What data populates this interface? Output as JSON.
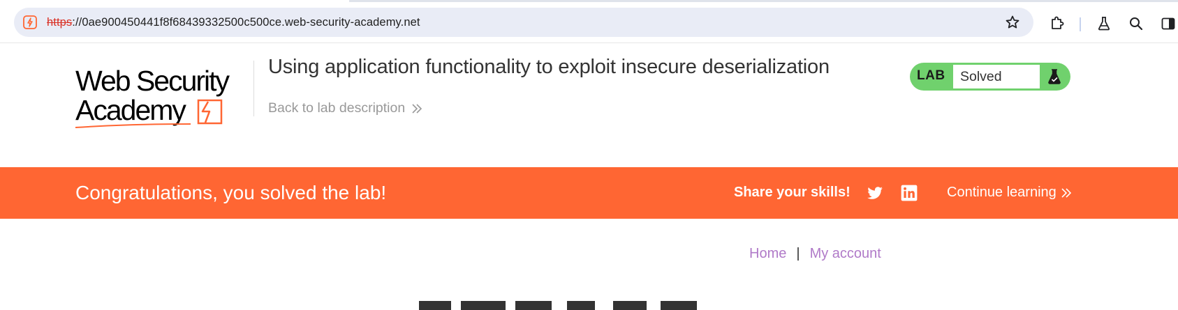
{
  "browser": {
    "url_scheme": "https",
    "url_rest": "://0ae900450441f8f68439332500c500ce.web-security-academy.net",
    "icons": [
      "site-info-icon",
      "bookmark-star-icon",
      "extensions-icon",
      "labs-flask-icon",
      "search-icon",
      "side-panel-icon"
    ]
  },
  "header": {
    "logo_text": "Web Security Academy",
    "lab_title": "Using application functionality to exploit insecure deserialization",
    "back_link": "Back to lab description",
    "lab_label": "LAB",
    "lab_status": "Solved",
    "status_color": "#70d16d"
  },
  "banner": {
    "message": "Congratulations, you solved the lab!",
    "share_label": "Share your skills!",
    "continue_label": "Continue learning",
    "color": "#ff6633"
  },
  "nav": {
    "home": "Home",
    "separator": "|",
    "account": "My account",
    "link_color": "#b07ac8"
  }
}
